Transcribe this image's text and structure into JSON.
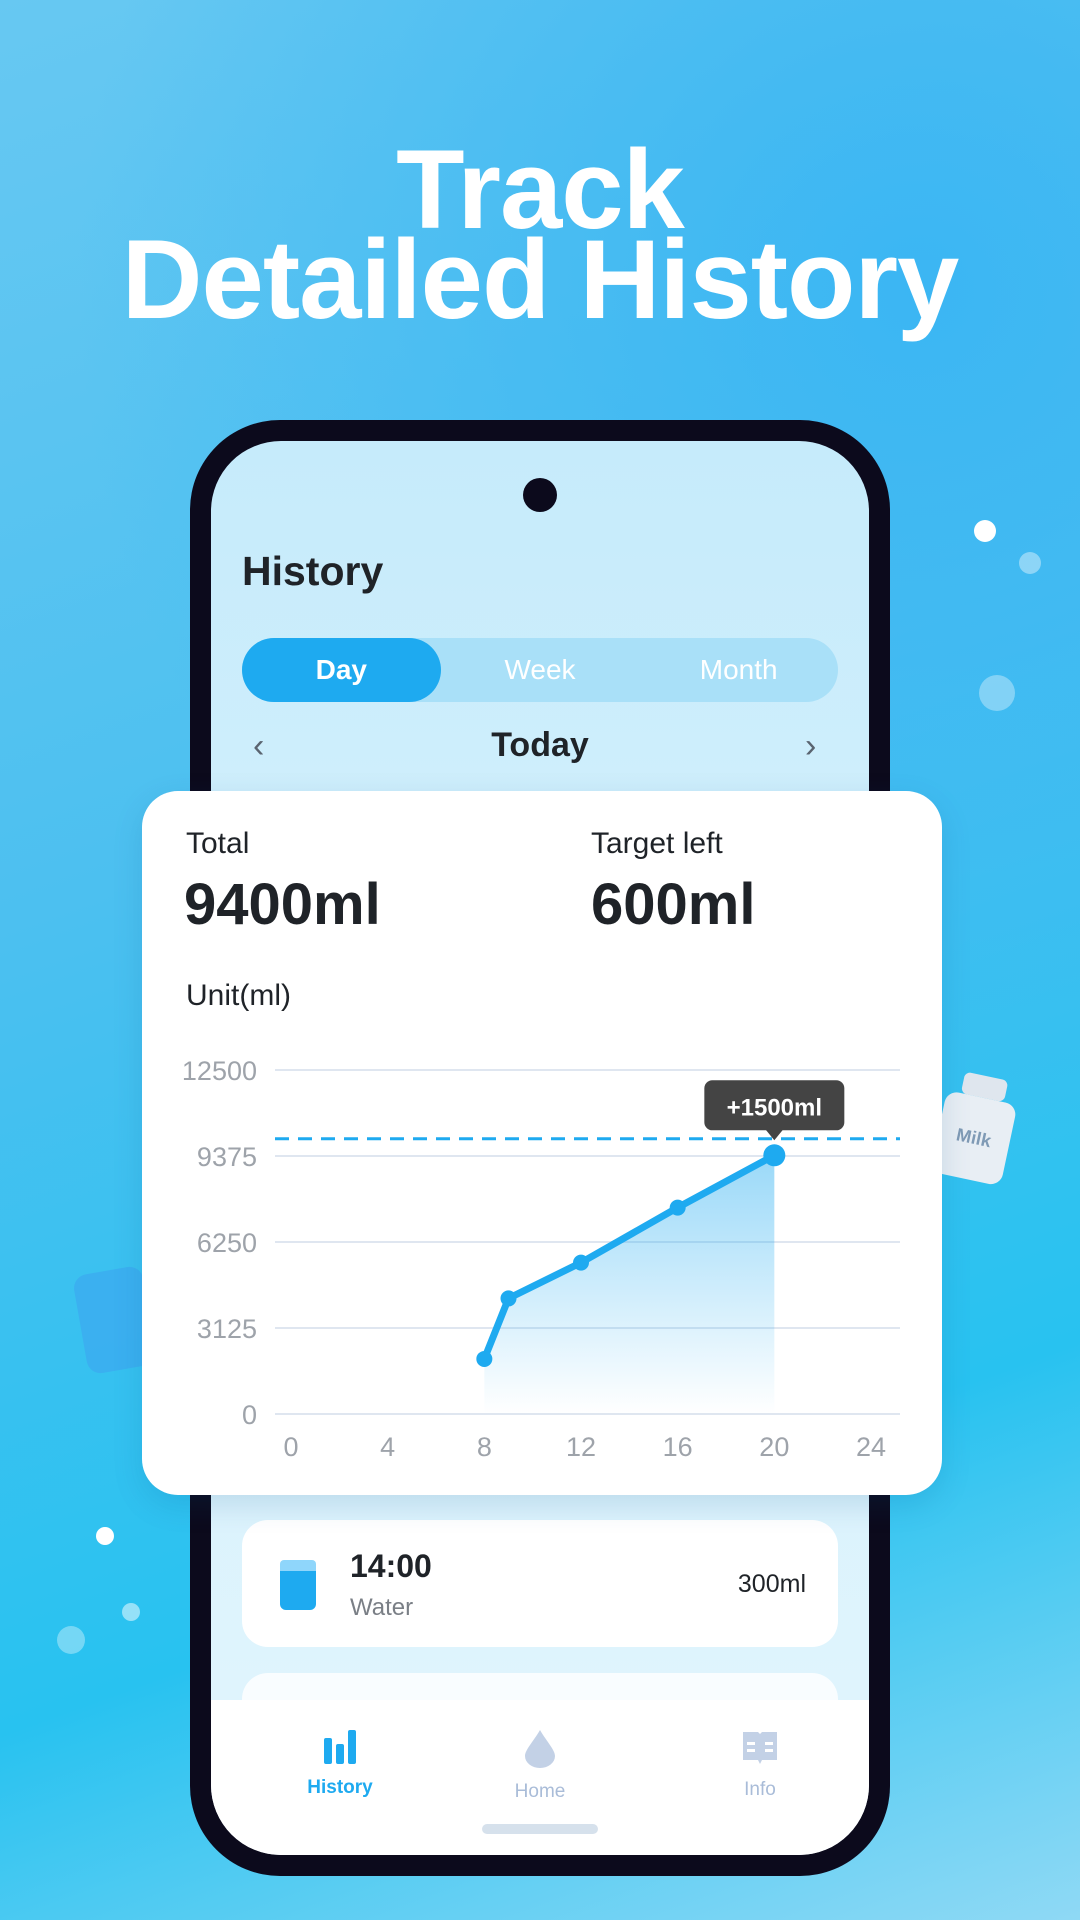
{
  "headline": {
    "line1": "Track",
    "line2": "Detailed History"
  },
  "app": {
    "title": "History",
    "tabs": [
      {
        "label": "Day",
        "active": true
      },
      {
        "label": "Week",
        "active": false
      },
      {
        "label": "Month",
        "active": false
      }
    ],
    "period": "Today",
    "summary": {
      "total_label": "Total",
      "total_value": "9400ml",
      "target_label": "Target left",
      "target_value": "600ml"
    },
    "unit_label": "Unit(ml)",
    "entries": [
      {
        "time": "14:00",
        "type": "Water",
        "amount": "300ml",
        "icon": "water-glass-icon"
      }
    ],
    "nav": [
      {
        "label": "History",
        "icon": "bar-chart-icon",
        "active": true
      },
      {
        "label": "Home",
        "icon": "water-drop-icon",
        "active": false
      },
      {
        "label": "Info",
        "icon": "book-icon",
        "active": false
      }
    ]
  },
  "colors": {
    "accent": "#1eaaf0",
    "inactive": "#a9bcd8",
    "text": "#1f2328"
  },
  "decorations": {
    "milk_label": "Milk"
  },
  "chart_data": {
    "type": "line",
    "x": [
      8,
      9,
      12,
      16,
      20
    ],
    "values": [
      2000,
      4200,
      5500,
      7500,
      9400
    ],
    "xticks": [
      "0",
      "4",
      "8",
      "12",
      "16",
      "20",
      "24"
    ],
    "yticks": [
      "0",
      "3125",
      "6250",
      "9375",
      "12500"
    ],
    "xlim": [
      0,
      24
    ],
    "ylim": [
      0,
      12500
    ],
    "target_line": 10000,
    "tooltip": "+1500ml",
    "ylabel": "Unit(ml)",
    "grid": true,
    "area_fill": true
  }
}
